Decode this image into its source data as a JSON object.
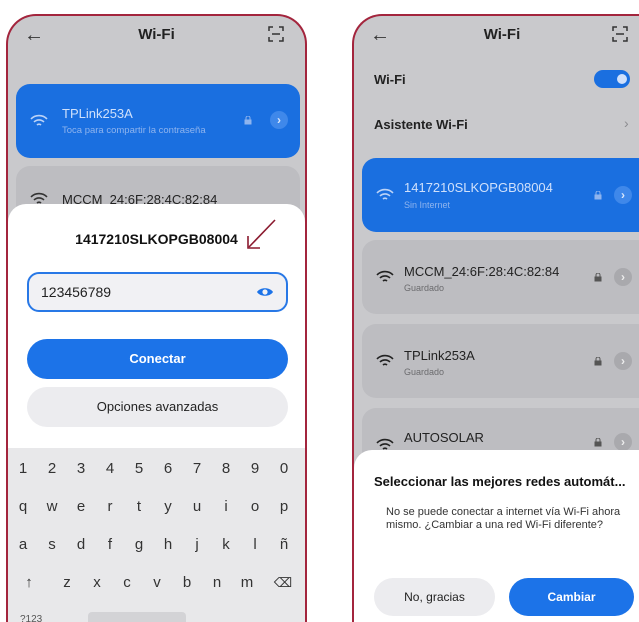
{
  "colors": {
    "accent": "#1c73e8",
    "frame": "#a3253d",
    "annotation": "#8b1a2f"
  },
  "left": {
    "header": {
      "title": "Wi-Fi",
      "back_icon": "back-arrow-icon",
      "scan_icon": "qr-scan-icon"
    },
    "networks": [
      {
        "name": "TPLink253A",
        "sub": "Toca para compartir la contraseña"
      },
      {
        "name": "MCCM_24:6F:28:4C:82:84"
      }
    ],
    "dialog": {
      "title": "1417210SLKOPGB08004",
      "password_value": "123456789",
      "connect_label": "Conectar",
      "advanced_label": "Opciones avanzadas"
    },
    "keyboard": {
      "row1": [
        "1",
        "2",
        "3",
        "4",
        "5",
        "6",
        "7",
        "8",
        "9",
        "0"
      ],
      "row2": [
        "q",
        "w",
        "e",
        "r",
        "t",
        "y",
        "u",
        "i",
        "o",
        "p"
      ],
      "row3": [
        "a",
        "s",
        "d",
        "f",
        "g",
        "h",
        "j",
        "k",
        "l",
        "ñ"
      ],
      "row4": [
        "↑",
        "z",
        "x",
        "c",
        "v",
        "b",
        "n",
        "m",
        "⌫"
      ],
      "num_label": "?123"
    }
  },
  "right": {
    "header": {
      "title": "Wi-Fi",
      "back_icon": "back-arrow-icon",
      "scan_icon": "qr-scan-icon"
    },
    "wifi_label": "Wi-Fi",
    "assistant_label": "Asistente Wi-Fi",
    "networks": [
      {
        "name": "1417210SLKOPGB08004",
        "sub": "Sin Internet"
      },
      {
        "name": "MCCM_24:6F:28:4C:82:84",
        "sub": "Guardado"
      },
      {
        "name": "TPLink253A",
        "sub": "Guardado"
      },
      {
        "name": "AUTOSOLAR"
      }
    ],
    "dialog": {
      "title": "Seleccionar las mejores redes automát...",
      "message": "No se puede conectar a internet vía Wi-Fi ahora mismo. ¿Cambiar a una red Wi-Fi diferente?",
      "no_label": "No, gracias",
      "yes_label": "Cambiar"
    }
  }
}
